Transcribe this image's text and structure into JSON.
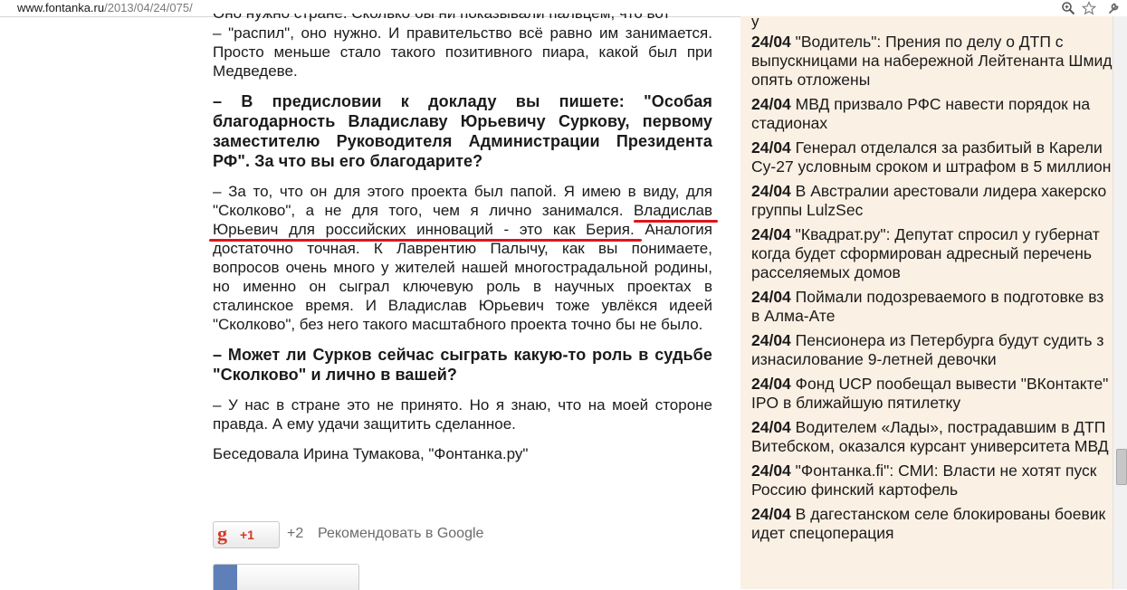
{
  "browser": {
    "url_domain": "www.fontanka.ru",
    "url_path": "/2013/04/24/075/"
  },
  "article": {
    "clipped_top_line": "Оно нужно стране. Сколько бы ни показывали пальцем, что вот",
    "paragraph_1": "– \"распил\", оно нужно. И правительство всё равно им занимается. Просто меньше стало такого позитивного пиара, какой был при Медведеве.",
    "question_1": "– В предисловии к докладу вы пишете: \"Особая благодарность Владиславу Юрьевичу Суркову, первому заместителю Руководителя Администрации Президента РФ\". За что вы его благодарите?",
    "answer_1_start": "– За то, что он для этого проекта был папой. Я имею в виду, для \"Сколково\", а не для того, чем я лично занимался.",
    "answer_1_highlight_a": "Владислав",
    "answer_1_highlight_b": "Юрьевич для российских инноваций - это как Берия.",
    "answer_1_end": "Аналогия достаточно точная. К Лаврентию Палычу, как вы понимаете, вопросов очень много у жителей нашей многострадальной родины, но именно он сыграл ключевую роль в научных проектах в сталинское время. И Владислав Юрьевич тоже увлёкся идеей \"Сколково\", без него такого масштабного проекта точно бы не было.",
    "question_2": "– Может ли Сурков сейчас сыграть какую-то роль в судьбе \"Сколково\" и лично в вашей?",
    "answer_2": "– У нас в стране это не принято. Но я знаю, что на моей стороне правда. А ему удачи защитить сделанное.",
    "byline": "Беседовала Ирина Тумакова, \"Фонтанка.ру\""
  },
  "gplus": {
    "g_letter": "g",
    "plus_label": "+1",
    "count": "+2",
    "recommend_label": "Рекомендовать в Google"
  },
  "news": {
    "top_clipped": "у",
    "items": [
      {
        "date": "24/04",
        "line1": "\"Водитель\": Прения по делу о ДТП с",
        "line2": "выпускницами на набережной Лейтенанта Шмид",
        "line3": "опять отложены"
      },
      {
        "date": "24/04",
        "line1": "МВД призвало РФС навести порядок на",
        "line2": "стадионах"
      },
      {
        "date": "24/04",
        "line1": "Генерал отделался за разбитый в Карели",
        "line2": "Су-27 условным сроком и штрафом в 5 миллион"
      },
      {
        "date": "24/04",
        "line1": "В Австралии арестовали лидера хакерско",
        "line2": "группы LulzSec"
      },
      {
        "date": "24/04",
        "line1": "\"Квадрат.ру\": Депутат спросил у губернат",
        "line2": "когда будет сформирован адресный перечень",
        "line3": "расселяемых домов"
      },
      {
        "date": "24/04",
        "line1": "Поймали подозреваемого в подготовке вз",
        "line2": "в Алма-Ате"
      },
      {
        "date": "24/04",
        "line1": "Пенсионера из Петербурга будут судить з",
        "line2": "изнасилование 9-летней девочки"
      },
      {
        "date": "24/04",
        "line1": "Фонд UCP пообещал вывести \"ВКонтакте\"",
        "line2": "IPO в ближайшую пятилетку"
      },
      {
        "date": "24/04",
        "line1": "Водителем «Лады», пострадавшим в ДТП",
        "line2": "Витебском, оказался курсант университета МВД"
      },
      {
        "date": "24/04",
        "line1": "\"Фонтанка.fi\": СМИ: Власти не хотят пуск",
        "line2": "Россию финский картофель"
      },
      {
        "date": "24/04",
        "line1": "В дагестанском селе блокированы боевик",
        "line2": "идет спецоперация"
      }
    ]
  },
  "colors": {
    "highlight_underline": "#e0141c",
    "news_background": "#fbf0e4",
    "gplus_red": "#d23a26"
  }
}
